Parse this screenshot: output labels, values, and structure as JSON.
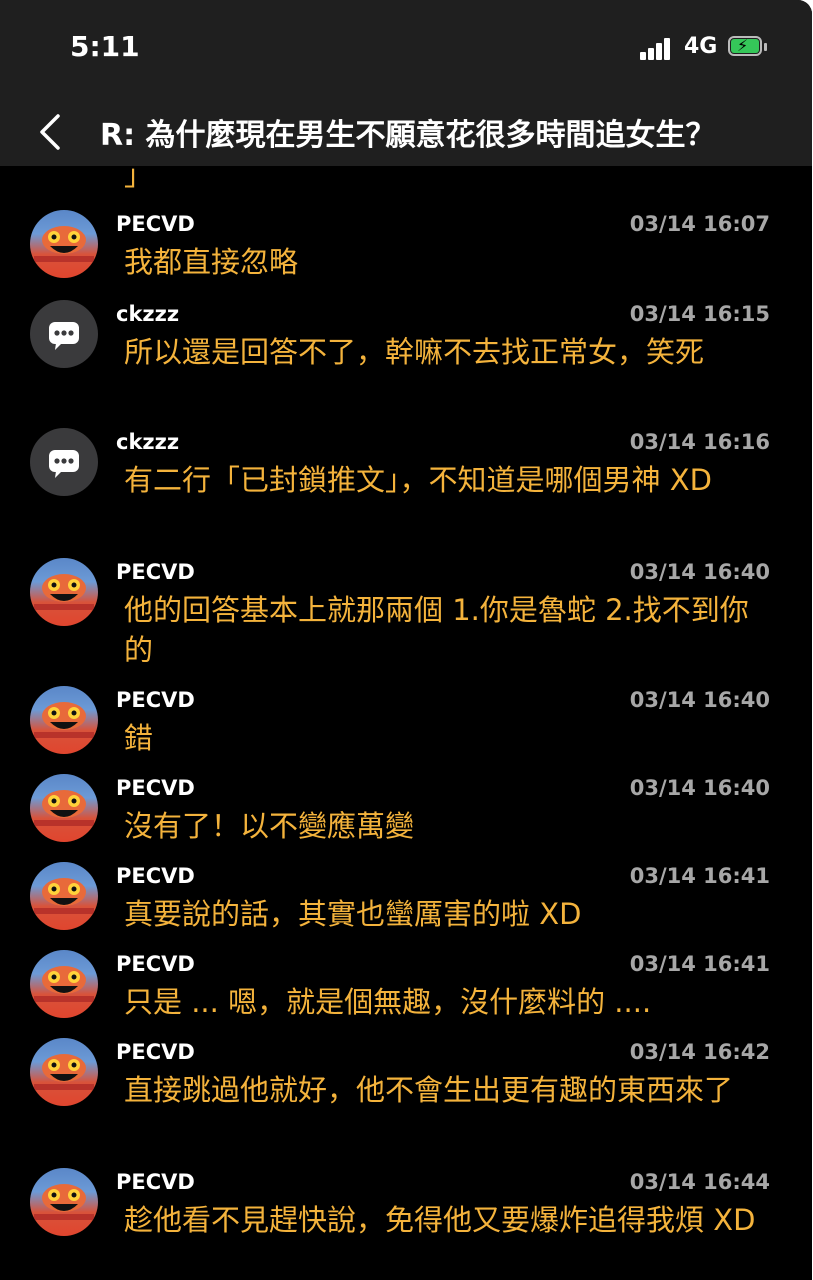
{
  "status": {
    "time": "5:11",
    "network": "4G"
  },
  "header": {
    "title": "R: 為什麼現在男生不願意花很多時間追女生？"
  },
  "top_fragment": "」",
  "comments": [
    {
      "author": "PECVD",
      "time": "03/14 16:07",
      "text": "我都直接忽略",
      "avatar": "face"
    },
    {
      "author": "ckzzz",
      "time": "03/14 16:15",
      "text": "所以還是回答不了，幹嘛不去找正常女，笑死",
      "avatar": "bubble"
    },
    {
      "author": "ckzzz",
      "time": "03/14 16:16",
      "text": "有二行「已封鎖推文」，不知道是哪個男神 XD",
      "avatar": "bubble"
    },
    {
      "author": "PECVD",
      "time": "03/14 16:40",
      "text": "他的回答基本上就那兩個 1.你是魯蛇 2.找不到你的",
      "avatar": "face"
    },
    {
      "author": "PECVD",
      "time": "03/14 16:40",
      "text": "錯",
      "avatar": "face"
    },
    {
      "author": "PECVD",
      "time": "03/14 16:40",
      "text": "沒有了！以不變應萬變",
      "avatar": "face"
    },
    {
      "author": "PECVD",
      "time": "03/14 16:41",
      "text": "真要說的話，其實也蠻厲害的啦 XD",
      "avatar": "face"
    },
    {
      "author": "PECVD",
      "time": "03/14 16:41",
      "text": "只是 ... 嗯，就是個無趣，沒什麼料的 ....",
      "avatar": "face"
    },
    {
      "author": "PECVD",
      "time": "03/14 16:42",
      "text": "直接跳過他就好，他不會生出更有趣的東西來了",
      "avatar": "face"
    },
    {
      "author": "PECVD",
      "time": "03/14 16:44",
      "text": "趁他看不見趕快說，免得他又要爆炸追得我煩 XD",
      "avatar": "face"
    }
  ]
}
